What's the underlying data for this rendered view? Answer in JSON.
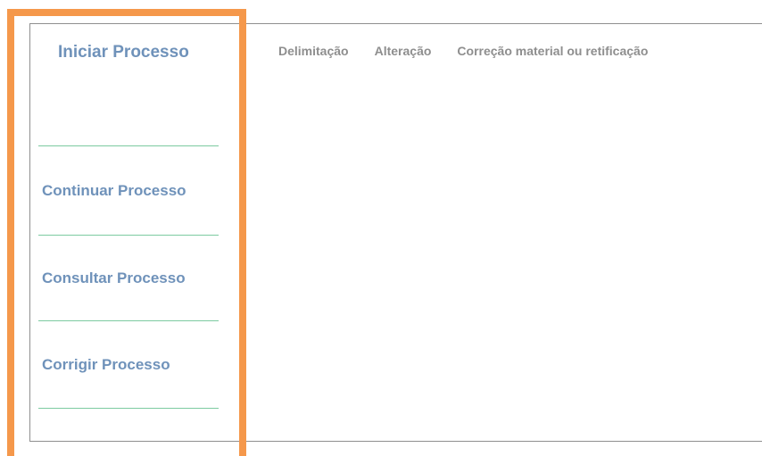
{
  "sidebar": {
    "title": "Iniciar Processo",
    "items": [
      {
        "label": "Continuar Processo"
      },
      {
        "label": "Consultar Processo"
      },
      {
        "label": "Corrigir Processo"
      }
    ]
  },
  "tabs": [
    {
      "label": "Delimitação"
    },
    {
      "label": "Alteração"
    },
    {
      "label": "Correção material ou retificação"
    }
  ],
  "colors": {
    "highlight": "#f5984b",
    "link": "#6f92ba",
    "divider": "#7ccaa0",
    "tab_text": "#8e8e8e"
  }
}
